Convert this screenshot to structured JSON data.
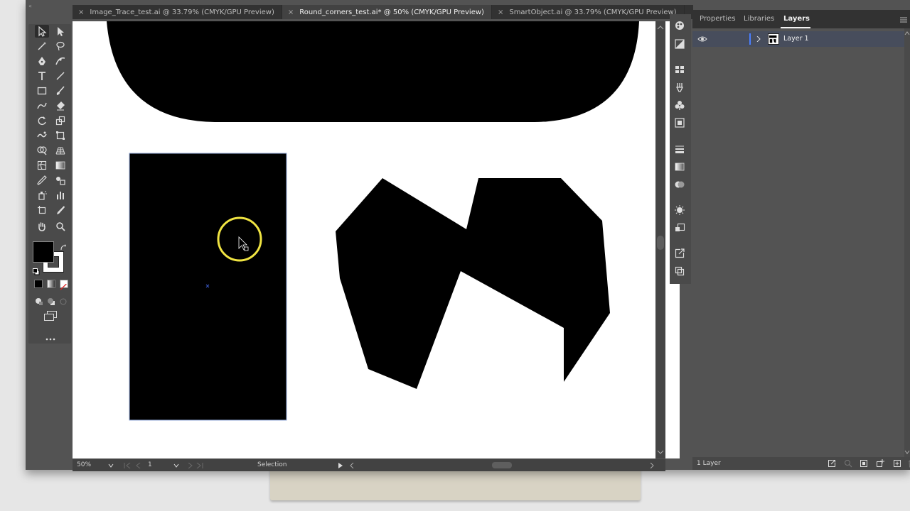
{
  "tabs": [
    {
      "label": "Image_Trace_test.ai @ 33.79% (CMYK/GPU Preview)",
      "active": false
    },
    {
      "label": "Round_corners_test.ai* @ 50% (CMYK/GPU Preview)",
      "active": true
    },
    {
      "label": "SmartObject.ai @ 33.79% (CMYK/GPU Preview)",
      "active": false
    }
  ],
  "tab_close_glyph": "×",
  "collapse_glyph": "«",
  "tools": [
    "selection-tool-icon",
    "direct-selection-tool-icon",
    "magic-wand-tool-icon",
    "lasso-tool-icon",
    "pen-tool-icon",
    "curvature-tool-icon",
    "type-tool-icon",
    "line-segment-tool-icon",
    "rectangle-tool-icon",
    "paintbrush-tool-icon",
    "shaper-tool-icon",
    "eraser-tool-icon",
    "rotate-tool-icon",
    "scale-tool-icon",
    "warp-tool-icon",
    "free-transform-tool-icon",
    "shape-builder-tool-icon",
    "perspective-grid-tool-icon",
    "mesh-tool-icon",
    "gradient-tool-icon",
    "eyedropper-tool-icon",
    "blend-tool-icon",
    "symbol-sprayer-tool-icon",
    "column-graph-tool-icon",
    "artboard-tool-icon",
    "slice-tool-icon",
    "hand-tool-icon",
    "zoom-tool-icon"
  ],
  "colors": {
    "fill": "#000000",
    "stroke": "#ffffff",
    "ui_dark": "#323232",
    "ui_mid": "#535353",
    "layer_row": "#474d5c",
    "layer_color": "#4a7fff",
    "cursor_ring": "#f0e442"
  },
  "status": {
    "zoom": "50%",
    "artboard": "1",
    "tool_name": "Selection"
  },
  "panel": {
    "tabs": [
      "Properties",
      "Libraries",
      "Layers"
    ],
    "active_tab": "Layers",
    "layer_name": "Layer 1",
    "layer_count": "1 Layer"
  },
  "strip_icons": [
    "appearance-icon",
    "color-guide-icon",
    "swatches-grid-icon",
    "brushes-icon",
    "symbols-icon",
    "graphic-styles-icon",
    "stroke-icon",
    "gradient-icon",
    "transparency-icon",
    "appearance-sun-icon",
    "image-trace-icon",
    "export-icon",
    "pathfinder-icon"
  ]
}
